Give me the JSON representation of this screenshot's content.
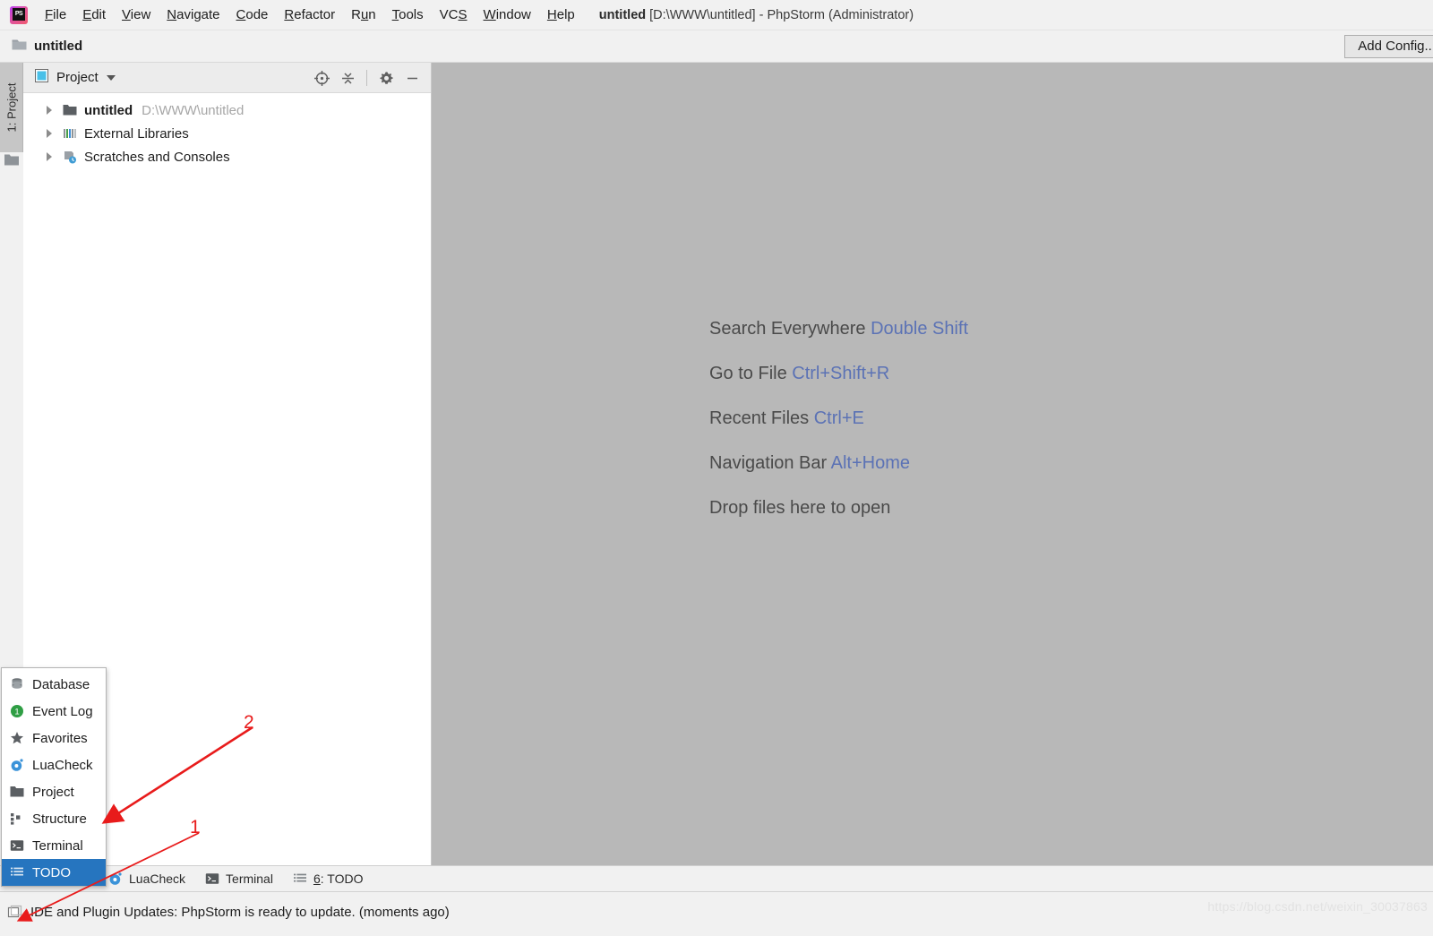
{
  "window": {
    "logo_icon": "phpstorm-logo-icon",
    "title_project": "untitled",
    "title_rest": " [D:\\WWW\\untitled] - PhpStorm (Administrator)"
  },
  "menubar": {
    "items": [
      {
        "label": "File",
        "mnemonic": "F"
      },
      {
        "label": "Edit",
        "mnemonic": "E"
      },
      {
        "label": "View",
        "mnemonic": "V"
      },
      {
        "label": "Navigate",
        "mnemonic": "N"
      },
      {
        "label": "Code",
        "mnemonic": "C"
      },
      {
        "label": "Refactor",
        "mnemonic": "R"
      },
      {
        "label": "Run",
        "mnemonic": "u"
      },
      {
        "label": "Tools",
        "mnemonic": "T"
      },
      {
        "label": "VCS",
        "mnemonic": "S"
      },
      {
        "label": "Window",
        "mnemonic": "W"
      },
      {
        "label": "Help",
        "mnemonic": "H"
      }
    ]
  },
  "navbar": {
    "folder_icon": "folder-icon",
    "project_name": "untitled",
    "add_config_label": "Add Config..."
  },
  "left_stripe": {
    "project_tab_label": "1: Project",
    "folder_icon": "folder-icon"
  },
  "project_panel": {
    "window_icon": "tool-window-icon",
    "title": "Project",
    "chevron_icon": "chevron-down-icon",
    "actions": [
      {
        "name": "locate-icon",
        "tooltip": "Select Opened File"
      },
      {
        "name": "collapse-all-icon",
        "tooltip": "Collapse All"
      },
      {
        "name": "gear-icon",
        "tooltip": "Settings"
      },
      {
        "name": "minimize-icon",
        "tooltip": "Hide"
      }
    ],
    "tree": [
      {
        "label": "untitled",
        "sub": "D:\\WWW\\untitled",
        "icon": "folder-icon",
        "bold": true,
        "expanded": false
      },
      {
        "label": "External Libraries",
        "sub": "",
        "icon": "libraries-icon",
        "bold": false,
        "expanded": false
      },
      {
        "label": "Scratches and Consoles",
        "sub": "",
        "icon": "scratches-icon",
        "bold": false,
        "expanded": false
      }
    ]
  },
  "editor": {
    "background_color": "#b8b8b8",
    "hints": [
      {
        "text": "Search Everywhere ",
        "key": "Double Shift"
      },
      {
        "text": "Go to File ",
        "key": "Ctrl+Shift+R"
      },
      {
        "text": "Recent Files ",
        "key": "Ctrl+E"
      },
      {
        "text": "Navigation Bar ",
        "key": "Alt+Home"
      },
      {
        "text": "Drop files here to open",
        "key": ""
      }
    ]
  },
  "bottom_stripe": {
    "tabs": [
      {
        "label": "LuaCheck",
        "icon": "luacheck-icon",
        "mnemonic": "",
        "hidden_behind_popup": true
      },
      {
        "label": "Terminal",
        "icon": "terminal-icon",
        "mnemonic": ""
      },
      {
        "label": "6: TODO",
        "icon": "todo-icon",
        "mnemonic": "6"
      }
    ]
  },
  "statusbar": {
    "icon": "notification-icon",
    "message": "IDE and Plugin Updates: PhpStorm is ready to update. (moments ago)",
    "watermark": "https://blog.csdn.net/weixin_30037863"
  },
  "popup_menu": {
    "items": [
      {
        "label": "Database",
        "icon": "database-icon",
        "selected": false
      },
      {
        "label": "Event Log",
        "icon": "event-log-icon",
        "selected": false
      },
      {
        "label": "Favorites",
        "icon": "star-icon",
        "selected": false
      },
      {
        "label": "LuaCheck",
        "icon": "luacheck-icon",
        "selected": false
      },
      {
        "label": "Project",
        "icon": "folder-icon",
        "selected": false
      },
      {
        "label": "Structure",
        "icon": "structure-icon",
        "selected": false
      },
      {
        "label": "Terminal",
        "icon": "terminal-icon",
        "selected": false
      },
      {
        "label": "TODO",
        "icon": "todo-icon",
        "selected": true
      }
    ]
  },
  "annotations": {
    "color": "#e81b1b",
    "markers": [
      {
        "label": "2",
        "points_to": "popup-item-structure"
      },
      {
        "label": "1",
        "points_to": "statusbar-notification-icon"
      }
    ]
  }
}
